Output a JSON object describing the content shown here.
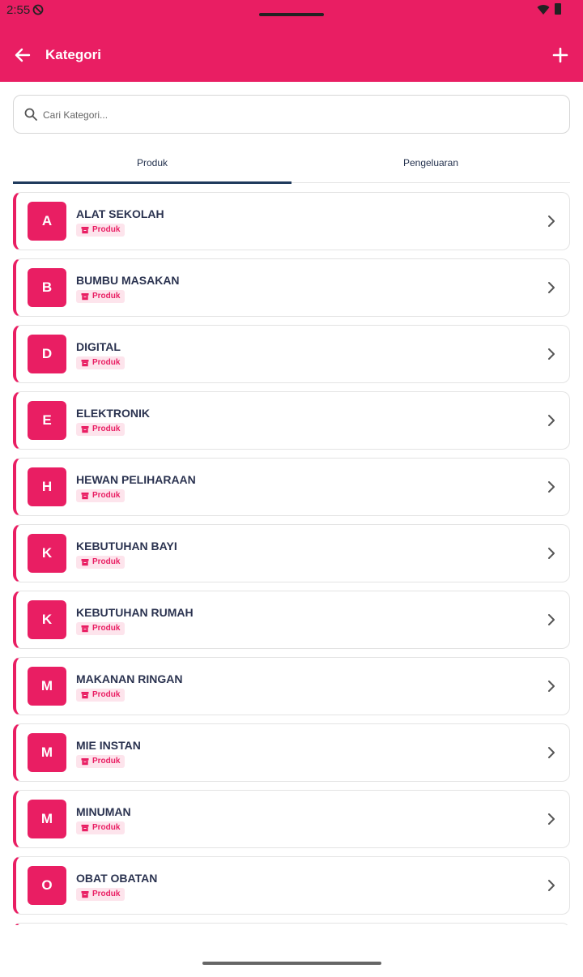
{
  "status_bar": {
    "time": "2:55"
  },
  "app_bar": {
    "title": "Kategori"
  },
  "search": {
    "placeholder": "Cari Kategori..."
  },
  "tabs": [
    {
      "label": "Produk",
      "active": true
    },
    {
      "label": "Pengeluaran",
      "active": false
    }
  ],
  "categories": [
    {
      "letter": "A",
      "name": "ALAT SEKOLAH",
      "badge": "Produk"
    },
    {
      "letter": "B",
      "name": "BUMBU MASAKAN",
      "badge": "Produk"
    },
    {
      "letter": "D",
      "name": "DIGITAL",
      "badge": "Produk"
    },
    {
      "letter": "E",
      "name": "ELEKTRONIK",
      "badge": "Produk"
    },
    {
      "letter": "H",
      "name": "HEWAN PELIHARAAN",
      "badge": "Produk"
    },
    {
      "letter": "K",
      "name": "KEBUTUHAN BAYI",
      "badge": "Produk"
    },
    {
      "letter": "K",
      "name": "KEBUTUHAN RUMAH",
      "badge": "Produk"
    },
    {
      "letter": "M",
      "name": "MAKANAN RINGAN",
      "badge": "Produk"
    },
    {
      "letter": "M",
      "name": "MIE INSTAN",
      "badge": "Produk"
    },
    {
      "letter": "M",
      "name": "MINUMAN",
      "badge": "Produk"
    },
    {
      "letter": "O",
      "name": "OBAT OBATAN",
      "badge": "Produk"
    }
  ],
  "colors": {
    "accent": "#E91E63",
    "badge_bg": "#fde4ec",
    "tab_indicator": "#1f3a5c"
  },
  "icons": {
    "back": "arrow-left-icon",
    "add": "plus-icon",
    "search": "search-icon",
    "badge": "archive-icon",
    "row": "chevron-right-icon"
  }
}
